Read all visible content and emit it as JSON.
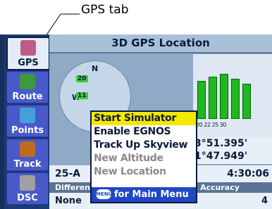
{
  "callout": {
    "text": "GPS tab"
  },
  "sidebar": {
    "tabs": [
      {
        "label": "GPS",
        "icon": "satellite-icon",
        "color": "#c05a8a"
      },
      {
        "label": "Route",
        "icon": "route-icon",
        "color": "#3c9a3c"
      },
      {
        "label": "Points",
        "icon": "points-icon",
        "color": "#46a0d8"
      },
      {
        "label": "Track",
        "icon": "track-icon",
        "color": "#c06a20"
      },
      {
        "label": "DSC",
        "icon": "dsc-icon",
        "color": "#a0a0a0"
      }
    ]
  },
  "page": {
    "title": "3D GPS Location",
    "skyview": {
      "north": "N",
      "west": "W",
      "sats": [
        "20",
        "11"
      ]
    },
    "bars": {
      "numbers": "20 22 25 30"
    },
    "coords": {
      "lat": "3°51.395'",
      "lon": "1°47.949'"
    },
    "strip": {
      "left": "25-A",
      "right": "4:30:06"
    },
    "fields": {
      "differential_label": "Differential",
      "accuracy_label": "Accuracy",
      "differential_value": "None",
      "accuracy_value": "4"
    }
  },
  "menu": {
    "items": [
      {
        "label": "Start Simulator",
        "state": "highlighted"
      },
      {
        "label": "Enable EGNOS",
        "state": "enabled"
      },
      {
        "label": "Track Up Skyview",
        "state": "enabled"
      },
      {
        "label": "New Altitude",
        "state": "disabled"
      },
      {
        "label": "New Location",
        "state": "disabled"
      }
    ],
    "footer_button": "MENU",
    "footer_text": "for Main Menu"
  },
  "colors": {
    "highlight": "#f5e800",
    "menu_footer": "#1f47c6",
    "signal_bar": "#1fb81f",
    "background": "#16305e"
  }
}
